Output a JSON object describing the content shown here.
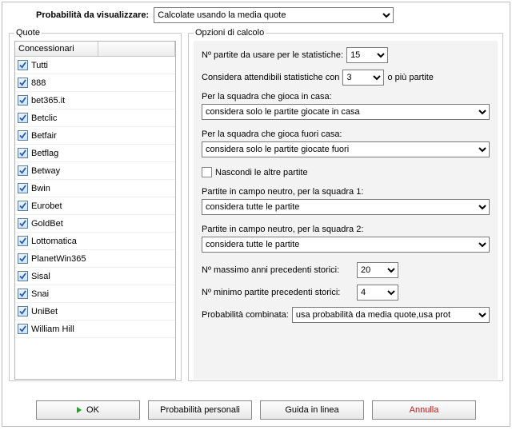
{
  "top": {
    "label": "Probabilità da visualizzare:",
    "value": "Calcolate usando la media quote"
  },
  "quote": {
    "legend": "Quote",
    "header": "Concessionari",
    "items": [
      {
        "label": "Tutti",
        "checked": true
      },
      {
        "label": "888",
        "checked": true
      },
      {
        "label": "bet365.it",
        "checked": true
      },
      {
        "label": "Betclic",
        "checked": true
      },
      {
        "label": "Betfair",
        "checked": true
      },
      {
        "label": "Betflag",
        "checked": true
      },
      {
        "label": "Betway",
        "checked": true
      },
      {
        "label": "Bwin",
        "checked": true
      },
      {
        "label": "Eurobet",
        "checked": true
      },
      {
        "label": "GoldBet",
        "checked": true
      },
      {
        "label": "Lottomatica",
        "checked": true
      },
      {
        "label": "PlanetWin365",
        "checked": true
      },
      {
        "label": "Sisal",
        "checked": true
      },
      {
        "label": "Snai",
        "checked": true
      },
      {
        "label": "UniBet",
        "checked": true
      },
      {
        "label": "William Hill",
        "checked": true
      }
    ]
  },
  "options": {
    "legend": "Opzioni di calcolo",
    "n_partite_label": "Nº partite da usare per le statistiche:",
    "n_partite_value": "15",
    "attendibili_pre": "Considera attendibili statistiche con",
    "attendibili_value": "3",
    "attendibili_post": "o più partite",
    "casa_label": "Per la squadra che gioca in casa:",
    "casa_value": "considera solo le partite giocate in casa",
    "fuori_label": "Per la squadra che gioca fuori casa:",
    "fuori_value": "considera solo le partite giocate fuori",
    "nascondi_label": "Nascondi le altre partite",
    "nascondi_checked": false,
    "neutro1_label": "Partite in campo neutro, per la squadra 1:",
    "neutro1_value": "considera tutte le partite",
    "neutro2_label": "Partite in campo neutro, per la squadra 2:",
    "neutro2_value": "considera tutte le partite",
    "max_anni_label": "Nº massimo anni precedenti storici:",
    "max_anni_value": "20",
    "min_partite_label": "Nº minimo partite precedenti storici:",
    "min_partite_value": "4",
    "prob_comb_label": "Probabilità combinata:",
    "prob_comb_value": "usa probabilità da media quote,usa prot"
  },
  "buttons": {
    "ok": "OK",
    "personal": "Probabilità personali",
    "guide": "Guida in linea",
    "cancel": "Annulla"
  }
}
